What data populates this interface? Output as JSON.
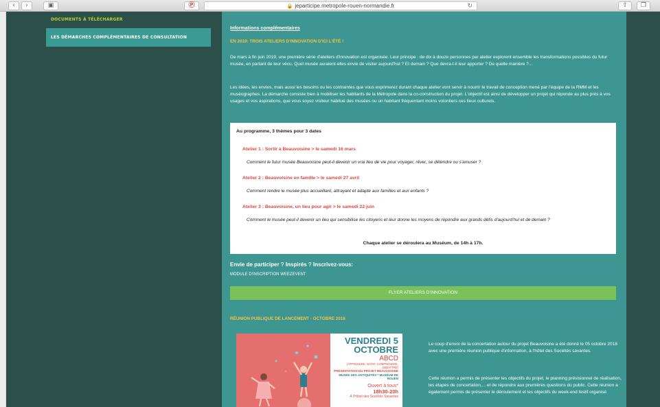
{
  "browser": {
    "url": "jeparticipe.metropole-rouen-normandie.fr"
  },
  "sidebar": {
    "items": [
      {
        "label": "DOCUMENTS À TÉLÉCHARGER"
      },
      {
        "label": "LES DÉMARCHES COMPLÉMENTAIRES DE CONSULTATION"
      }
    ]
  },
  "main": {
    "info_title": "Informations complémentaires",
    "section1_title": "EN 2019: TROIS ATELIERS D'INNOVATION D'ICI L'ÉTÉ !",
    "para1": "De mars à fin juin 2019, une première série d'ateliers d'innovation est organisée. Leur principe : de dix à douze personnes par atelier explorent ensemble les transformations possibles du futur musée, en partant de leur vécu. Quel musée auraient-elles envie de visiter aujourd'hui ? Et demain ? Que devra-t-il leur apporter ? De quelle manière ?...",
    "para2": "Les idées, les envies, mais aussi les besoins ou les contraintes que vous exprimerez durant chaque atelier vont servir à nourrir le travail de conception mené par l'équipe de la RMM et les muséographes. La démarche consiste bien à mobiliser les habitants de la Métropole dans la co-construction du projet. L'objectif est ainsi de développer un projet qui réponde au plus près à vos usages et vos aspirations, que vous soyez visiteur habitué des musées ou un habitant fréquentant moins volontiers ces lieux culturels.",
    "program": {
      "title": "Au programme, 3 thèmes pour 3 dates",
      "ateliers": [
        {
          "title": "Atelier 1 : Sortir à Beauvoisine > le samedi 16 mars",
          "question": "Comment le futur musée Beauvoisine peut-il devenir un vrai lieu de vie pour voyager, rêver, se détendre ou s'amuser ?"
        },
        {
          "title": "Atelier 2 : Beauvoisine en famille > le samedi 27 avril",
          "question": "Comment rendre le musée plus accueillant, attrayant et adapté aux familles et aux enfants ?"
        },
        {
          "title": "Atelier 3 : Beauvoisine, un lieu pour agir > le samedi 22 juin",
          "question": "Comment le musée peut-il devenir un lieu qui sensibilise les citoyens et leur donne les moyens de répondre aux grands défis d'aujourd'hui et de demain ?"
        }
      ],
      "footer": "Chaque atelier se déroulera au Muséum, de 14h à 17h."
    },
    "envie": "Envie de participer ? Inspirés ? Inscrivez-vous:",
    "module": "MODULE D'INSCRIPTION WEEZEVENT",
    "flyer_button": "FLYER ATELIERS D'INNOVATION",
    "section2_title": "RÉUNION PUBLIQUE DE LANCEMENT - OCTOBRE 2018",
    "poster": {
      "l1": "VENDREDI 5",
      "l2": "OCTOBRE",
      "l3": "ABCD",
      "l4": "(APPRENDRE, BATIR, COMPRENDRE, DEBATTRE)",
      "l5": "PRÉSENTATION DU PROJET BEAUVOISINE",
      "l6": "MUSÉE DES ANTIQUITÉS * MUSÉUM DE ROUEN",
      "l7": "Ouvert à tous*",
      "l8": "18h30-20h",
      "l9": "À l'Hôtel des Sociétés Savantes"
    },
    "concert1": "Le coup d'envoi de la concertation autour du projet Beauvoisine a été donné le 05 octobre 2018 avec une première réunion publique d'information, à l'hôtel des Sociétés savantes.",
    "concert2": "Cette réunion a permis de présenter les objectifs du projet, le planning prévisionnel de réalisation, les étapes de concertation,... et de répondre aux premières questions du public. Cette réunion a également permis de présenter le déroulement et les objectifs du week-end festif organisé"
  },
  "colors": {
    "page_bg": "#2c4f4a",
    "main_bg": "#3d9691",
    "accent_yellow": "#f6c343",
    "accent_red": "#e0453b",
    "button_green": "#7ac05b",
    "sidebar_green": "#b6d43a"
  }
}
